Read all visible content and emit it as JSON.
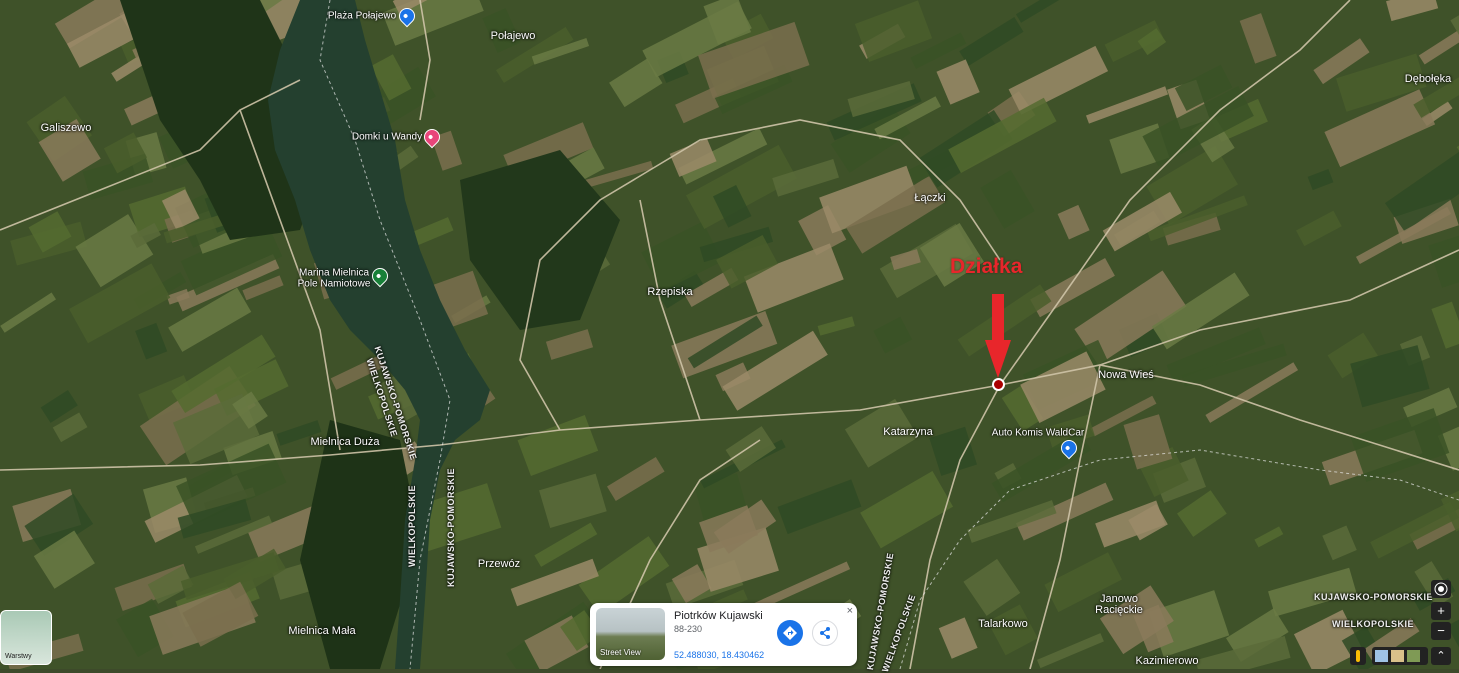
{
  "places": {
    "plaza": "Plaża Połajewo",
    "polajewo": "Połajewo",
    "galiszewo": "Galiszewo",
    "domki": "Domki u Wandy",
    "laczki": "Łączki",
    "debolека": "Dębołęka",
    "marina": "Marina Mielnica",
    "marina2": "Pole Namiotowe",
    "rzepiska": "Rzepiska",
    "nowa_wies": "Nowa Wieś",
    "katarzyna": "Katarzyna",
    "auto_komis": "Auto Komis WaldCar",
    "mielnica_duza": "Mielnica Duża",
    "przewoz": "Przewóz",
    "mielnica_mala": "Mielnica Mała",
    "janowo1": "Janowo",
    "janowo2": "Racięckie",
    "talarkowo": "Talarkowo",
    "kazimierowo": "Kazimierowo"
  },
  "regions": {
    "kujawsko_pomorskie_1": "KUJAWSKO-POMORSKIE",
    "wielkopolskie_1": "WIELKOPOLSKIE",
    "wielkopolskie_2": "WIELKOPOLSKIE",
    "kujawsko_pomorskie_2": "KUJAWSKO-POMORSKIE",
    "kujawsko_pomorskie_3": "KUJAWSKO-POMORSKIE",
    "wielkopolskie_3": "WIELKOPOLSKIE",
    "kujawsko_pomorskie_4": "KUJAWSKO-POMORSKIE",
    "wielkopolskie_4": "WIELKOPOLSKIE"
  },
  "annotation": {
    "label": "Działka",
    "color": "#e8262b"
  },
  "info_card": {
    "title": "Piotrków Kujawski",
    "zip": "88-230",
    "coords": "52.488030, 18.430462",
    "street_view_label": "Street View",
    "close": "×"
  },
  "controls": {
    "layers_label": "Warstwy",
    "zoom_in": "+",
    "zoom_out": "−",
    "expand": "⌃"
  },
  "colors": {
    "lake": "#24402f",
    "fields_dark": "#2f4a24",
    "fields_light": "#8a7a5a",
    "road": "#cfc4a8"
  }
}
